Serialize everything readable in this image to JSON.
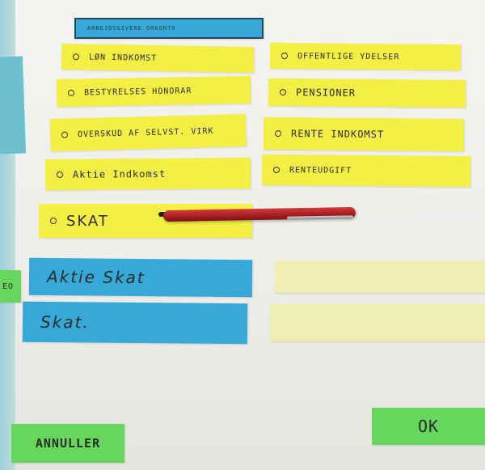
{
  "header_label": "ARBEJDSGIVERE ORKONTO",
  "options_left": [
    {
      "label": "LØN INDKOMST"
    },
    {
      "label": "BESTYRELSES HONORAR"
    },
    {
      "label": "OVERSKUD AF SELVST. VIRK"
    },
    {
      "label": "Aktie Indkomst"
    },
    {
      "label": "SKAT"
    }
  ],
  "options_right": [
    {
      "label": "OFFENTLIGE YDELSER"
    },
    {
      "label": "PENSIONER"
    },
    {
      "label": "RENTE INDKOMST"
    },
    {
      "label": "RENTEUDGIFT"
    }
  ],
  "fields": [
    {
      "label": "Aktie Skat"
    },
    {
      "label": "Skat."
    }
  ],
  "buttons": {
    "cancel": "ANNULLER",
    "ok": "OK"
  },
  "edge_fragment": "EO",
  "colors": {
    "option_yellow": "#f3ef44",
    "field_blue": "#37a9d8",
    "value_cream": "#f1eeb4",
    "button_green": "#66d65d"
  }
}
